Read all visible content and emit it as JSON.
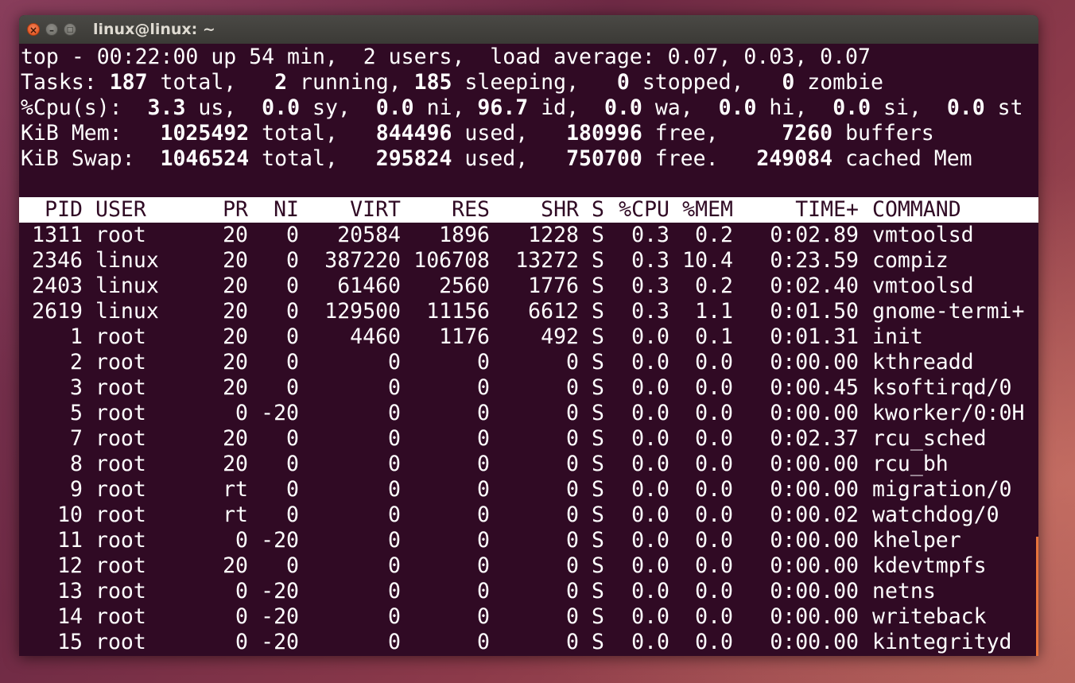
{
  "window": {
    "title": "linux@linux: ~",
    "close_glyph": "×",
    "min_glyph": "–",
    "max_glyph": "□"
  },
  "summary": {
    "line1": "top - 00:22:00 up 54 min,  2 users,  load average: 0.07, 0.03, 0.07",
    "tasks": {
      "label": "Tasks: ",
      "total": "187",
      "total_label": " total,   ",
      "running": "2",
      "running_label": " running, ",
      "sleeping": "185",
      "sleeping_label": " sleeping,   ",
      "stopped": "0",
      "stopped_label": " stopped,   ",
      "zombie": "0",
      "zombie_label": " zombie"
    },
    "cpu": {
      "label": "%Cpu(s):  ",
      "us": "3.3",
      "us_label": " us,  ",
      "sy": "0.0",
      "sy_label": " sy,  ",
      "ni": "0.0",
      "ni_label": " ni, ",
      "id": "96.7",
      "id_label": " id,  ",
      "wa": "0.0",
      "wa_label": " wa,  ",
      "hi": "0.0",
      "hi_label": " hi,  ",
      "si": "0.0",
      "si_label": " si,  ",
      "st": "0.0",
      "st_label": " st"
    },
    "mem": {
      "label": "KiB Mem:   ",
      "total": "1025492",
      "total_label": " total,   ",
      "used": "844496",
      "used_label": " used,   ",
      "free": "180996",
      "free_label": " free,     ",
      "buffers": "7260",
      "buffers_label": " buffers"
    },
    "swap": {
      "label": "KiB Swap:  ",
      "total": "1046524",
      "total_label": " total,   ",
      "used": "295824",
      "used_label": " used,   ",
      "free": "750700",
      "free_label": " free.   ",
      "cached": "249084",
      "cached_label": " cached Mem"
    }
  },
  "columns": {
    "pid": "PID",
    "user": "USER",
    "pr": "PR",
    "ni": "NI",
    "virt": "VIRT",
    "res": "RES",
    "shr": "SHR",
    "s": "S",
    "cpu": "%CPU",
    "mem": "%MEM",
    "time": "TIME+",
    "command": "COMMAND"
  },
  "processes": [
    {
      "pid": "1311",
      "user": "root",
      "pr": "20",
      "ni": "0",
      "virt": "20584",
      "res": "1896",
      "shr": "1228",
      "s": "S",
      "cpu": "0.3",
      "mem": "0.2",
      "time": "0:02.89",
      "command": "vmtoolsd"
    },
    {
      "pid": "2346",
      "user": "linux",
      "pr": "20",
      "ni": "0",
      "virt": "387220",
      "res": "106708",
      "shr": "13272",
      "s": "S",
      "cpu": "0.3",
      "mem": "10.4",
      "time": "0:23.59",
      "command": "compiz"
    },
    {
      "pid": "2403",
      "user": "linux",
      "pr": "20",
      "ni": "0",
      "virt": "61460",
      "res": "2560",
      "shr": "1776",
      "s": "S",
      "cpu": "0.3",
      "mem": "0.2",
      "time": "0:02.40",
      "command": "vmtoolsd"
    },
    {
      "pid": "2619",
      "user": "linux",
      "pr": "20",
      "ni": "0",
      "virt": "129500",
      "res": "11156",
      "shr": "6612",
      "s": "S",
      "cpu": "0.3",
      "mem": "1.1",
      "time": "0:01.50",
      "command": "gnome-termi+"
    },
    {
      "pid": "1",
      "user": "root",
      "pr": "20",
      "ni": "0",
      "virt": "4460",
      "res": "1176",
      "shr": "492",
      "s": "S",
      "cpu": "0.0",
      "mem": "0.1",
      "time": "0:01.31",
      "command": "init"
    },
    {
      "pid": "2",
      "user": "root",
      "pr": "20",
      "ni": "0",
      "virt": "0",
      "res": "0",
      "shr": "0",
      "s": "S",
      "cpu": "0.0",
      "mem": "0.0",
      "time": "0:00.00",
      "command": "kthreadd"
    },
    {
      "pid": "3",
      "user": "root",
      "pr": "20",
      "ni": "0",
      "virt": "0",
      "res": "0",
      "shr": "0",
      "s": "S",
      "cpu": "0.0",
      "mem": "0.0",
      "time": "0:00.45",
      "command": "ksoftirqd/0"
    },
    {
      "pid": "5",
      "user": "root",
      "pr": "0",
      "ni": "-20",
      "virt": "0",
      "res": "0",
      "shr": "0",
      "s": "S",
      "cpu": "0.0",
      "mem": "0.0",
      "time": "0:00.00",
      "command": "kworker/0:0H"
    },
    {
      "pid": "7",
      "user": "root",
      "pr": "20",
      "ni": "0",
      "virt": "0",
      "res": "0",
      "shr": "0",
      "s": "S",
      "cpu": "0.0",
      "mem": "0.0",
      "time": "0:02.37",
      "command": "rcu_sched"
    },
    {
      "pid": "8",
      "user": "root",
      "pr": "20",
      "ni": "0",
      "virt": "0",
      "res": "0",
      "shr": "0",
      "s": "S",
      "cpu": "0.0",
      "mem": "0.0",
      "time": "0:00.00",
      "command": "rcu_bh"
    },
    {
      "pid": "9",
      "user": "root",
      "pr": "rt",
      "ni": "0",
      "virt": "0",
      "res": "0",
      "shr": "0",
      "s": "S",
      "cpu": "0.0",
      "mem": "0.0",
      "time": "0:00.00",
      "command": "migration/0"
    },
    {
      "pid": "10",
      "user": "root",
      "pr": "rt",
      "ni": "0",
      "virt": "0",
      "res": "0",
      "shr": "0",
      "s": "S",
      "cpu": "0.0",
      "mem": "0.0",
      "time": "0:00.02",
      "command": "watchdog/0"
    },
    {
      "pid": "11",
      "user": "root",
      "pr": "0",
      "ni": "-20",
      "virt": "0",
      "res": "0",
      "shr": "0",
      "s": "S",
      "cpu": "0.0",
      "mem": "0.0",
      "time": "0:00.00",
      "command": "khelper"
    },
    {
      "pid": "12",
      "user": "root",
      "pr": "20",
      "ni": "0",
      "virt": "0",
      "res": "0",
      "shr": "0",
      "s": "S",
      "cpu": "0.0",
      "mem": "0.0",
      "time": "0:00.00",
      "command": "kdevtmpfs"
    },
    {
      "pid": "13",
      "user": "root",
      "pr": "0",
      "ni": "-20",
      "virt": "0",
      "res": "0",
      "shr": "0",
      "s": "S",
      "cpu": "0.0",
      "mem": "0.0",
      "time": "0:00.00",
      "command": "netns"
    },
    {
      "pid": "14",
      "user": "root",
      "pr": "0",
      "ni": "-20",
      "virt": "0",
      "res": "0",
      "shr": "0",
      "s": "S",
      "cpu": "0.0",
      "mem": "0.0",
      "time": "0:00.00",
      "command": "writeback"
    },
    {
      "pid": "15",
      "user": "root",
      "pr": "0",
      "ni": "-20",
      "virt": "0",
      "res": "0",
      "shr": "0",
      "s": "S",
      "cpu": "0.0",
      "mem": "0.0",
      "time": "0:00.00",
      "command": "kintegrityd"
    }
  ],
  "colors": {
    "terminal_bg": "#300a24",
    "terminal_fg": "#ffffff",
    "close_button": "#e35a22",
    "scroll_accent": "#e8743b"
  },
  "icons": {
    "close": "close-icon",
    "minimize": "minimize-icon",
    "maximize": "maximize-icon"
  }
}
